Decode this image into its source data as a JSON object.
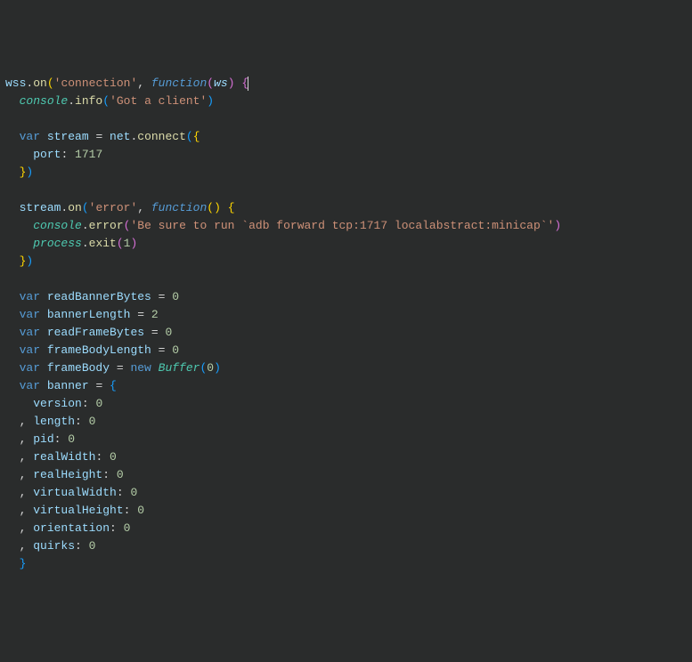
{
  "code": {
    "line1": {
      "obj": "wss",
      "dot1": ".",
      "method": "on",
      "p1": "(",
      "str": "'connection'",
      "comma": ", ",
      "kw": "function",
      "p2": "(",
      "param": "ws",
      "p3": ") ",
      "brace": "{"
    },
    "line2": {
      "indent": "  ",
      "obj": "console",
      "dot": ".",
      "method": "info",
      "p1": "(",
      "str": "'Got a client'",
      "p2": ")"
    },
    "line4": {
      "indent": "  ",
      "kw": "var",
      "sp": " ",
      "name": "stream",
      "eq": " = ",
      "obj": "net",
      "dot": ".",
      "method": "connect",
      "p1": "(",
      "brace": "{"
    },
    "line5": {
      "indent": "    ",
      "prop": "port",
      "colon": ": ",
      "val": "1717"
    },
    "line6": {
      "indent": "  ",
      "brace": "}",
      "p": ")"
    },
    "line8": {
      "indent": "  ",
      "obj": "stream",
      "dot": ".",
      "method": "on",
      "p1": "(",
      "str": "'error'",
      "comma": ", ",
      "kw": "function",
      "p2": "() ",
      "brace": "{"
    },
    "line9": {
      "indent": "    ",
      "obj": "console",
      "dot": ".",
      "method": "error",
      "p1": "(",
      "str": "'Be sure to run `adb forward tcp:1717 localabstract:minicap`'",
      "p2": ")"
    },
    "line10": {
      "indent": "    ",
      "obj": "process",
      "dot": ".",
      "method": "exit",
      "p1": "(",
      "val": "1",
      "p2": ")"
    },
    "line11": {
      "indent": "  ",
      "brace": "}",
      "p": ")"
    },
    "line13": {
      "indent": "  ",
      "kw": "var",
      "sp": " ",
      "name": "readBannerBytes",
      "eq": " = ",
      "val": "0"
    },
    "line14": {
      "indent": "  ",
      "kw": "var",
      "sp": " ",
      "name": "bannerLength",
      "eq": " = ",
      "val": "2"
    },
    "line15": {
      "indent": "  ",
      "kw": "var",
      "sp": " ",
      "name": "readFrameBytes",
      "eq": " = ",
      "val": "0"
    },
    "line16": {
      "indent": "  ",
      "kw": "var",
      "sp": " ",
      "name": "frameBodyLength",
      "eq": " = ",
      "val": "0"
    },
    "line17": {
      "indent": "  ",
      "kw": "var",
      "sp": " ",
      "name": "frameBody",
      "eq": " = ",
      "new": "new",
      "sp2": " ",
      "type": "Buffer",
      "p1": "(",
      "val": "0",
      "p2": ")"
    },
    "line18": {
      "indent": "  ",
      "kw": "var",
      "sp": " ",
      "name": "banner",
      "eq": " = ",
      "brace": "{"
    },
    "line19": {
      "indent": "    ",
      "prop": "version",
      "colon": ": ",
      "val": "0"
    },
    "line20": {
      "indent": "  , ",
      "prop": "length",
      "colon": ": ",
      "val": "0"
    },
    "line21": {
      "indent": "  , ",
      "prop": "pid",
      "colon": ": ",
      "val": "0"
    },
    "line22": {
      "indent": "  , ",
      "prop": "realWidth",
      "colon": ": ",
      "val": "0"
    },
    "line23": {
      "indent": "  , ",
      "prop": "realHeight",
      "colon": ": ",
      "val": "0"
    },
    "line24": {
      "indent": "  , ",
      "prop": "virtualWidth",
      "colon": ": ",
      "val": "0"
    },
    "line25": {
      "indent": "  , ",
      "prop": "virtualHeight",
      "colon": ": ",
      "val": "0"
    },
    "line26": {
      "indent": "  , ",
      "prop": "orientation",
      "colon": ": ",
      "val": "0"
    },
    "line27": {
      "indent": "  , ",
      "prop": "quirks",
      "colon": ": ",
      "val": "0"
    },
    "line28": {
      "indent": "  ",
      "brace": "}"
    }
  }
}
